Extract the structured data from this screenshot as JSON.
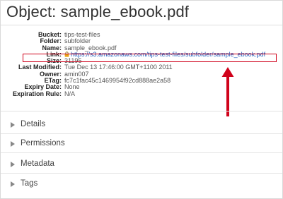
{
  "header": {
    "title": "Object: sample_ebook.pdf"
  },
  "properties": [
    {
      "key": "Bucket:",
      "value": "tips-test-files"
    },
    {
      "key": "Folder:",
      "value": "subfolder"
    },
    {
      "key": "Name:",
      "value": "sample_ebook.pdf"
    },
    {
      "key": "Link:",
      "value": "https://s3.amazonaws.com/tips-test-files/subfolder/sample_ebook.pdf"
    },
    {
      "key": "Size:",
      "value": "31195"
    },
    {
      "key": "Last Modified:",
      "value": "Tue Dec 13 17:46:00 GMT+1100 2011"
    },
    {
      "key": "Owner:",
      "value": "amin007"
    },
    {
      "key": "ETag:",
      "value": "fc7c1fac45c1469954f92cd888ae2a58"
    },
    {
      "key": "Expiry Date:",
      "value": "None"
    },
    {
      "key": "Expiration Rule:",
      "value": "N/A"
    }
  ],
  "sections": [
    {
      "label": "Details"
    },
    {
      "label": "Permissions"
    },
    {
      "label": "Metadata"
    },
    {
      "label": "Tags"
    }
  ],
  "icons": {
    "lock": "lock-icon",
    "section_toggle": "triangle-right-icon",
    "annotation_arrow": "arrow-up-icon"
  },
  "colors": {
    "link": "#1a5dbf",
    "annotation": "#d0021b",
    "lock": "#e8a317"
  }
}
